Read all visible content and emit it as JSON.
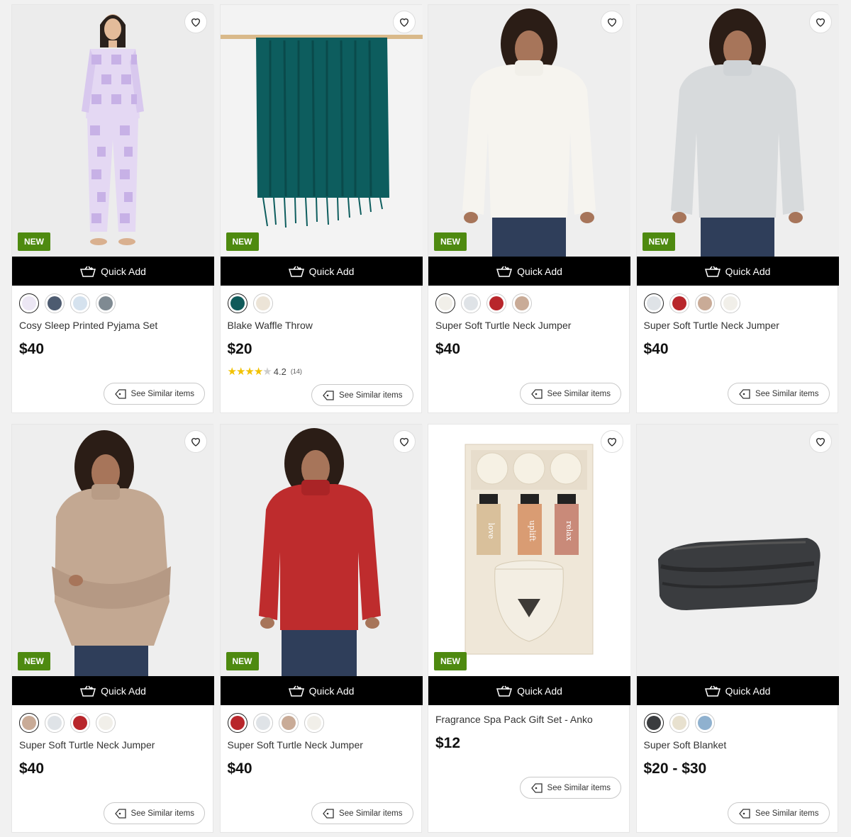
{
  "ui": {
    "quick_add": "Quick Add",
    "see_similar": "See Similar items",
    "new_badge": "NEW"
  },
  "products": [
    {
      "name": "Cosy Sleep Printed Pyjama Set",
      "price": "$40",
      "is_new": true,
      "swatches": [
        "#ece7f4",
        "#4d5b70",
        "#d5e2ee",
        "#7f8a92"
      ],
      "image": "pyjama"
    },
    {
      "name": "Blake Waffle Throw",
      "price": "$20",
      "is_new": true,
      "swatches": [
        "#0f5a5a",
        "#ece4d7"
      ],
      "rating": "4.2",
      "reviews": "(14)",
      "image": "throw"
    },
    {
      "name": "Super Soft Turtle Neck Jumper",
      "price": "$40",
      "is_new": true,
      "swatches": [
        "#f1efe9",
        "#dfe3e7",
        "#b8262b",
        "#c9ab97"
      ],
      "image": "jumper-cream"
    },
    {
      "name": "Super Soft Turtle Neck Jumper",
      "price": "$40",
      "is_new": true,
      "swatches": [
        "#dfe3e7",
        "#b8262b",
        "#c9ab97",
        "#f1efe9"
      ],
      "image": "jumper-grey"
    },
    {
      "name": "Super Soft Turtle Neck Jumper",
      "price": "$40",
      "is_new": true,
      "swatches": [
        "#c9ab97",
        "#dfe3e7",
        "#b8262b",
        "#f1efe9"
      ],
      "image": "jumper-beige"
    },
    {
      "name": "Super Soft Turtle Neck Jumper",
      "price": "$40",
      "is_new": true,
      "swatches": [
        "#b8262b",
        "#dfe3e7",
        "#c9ab97",
        "#f1efe9"
      ],
      "image": "jumper-red"
    },
    {
      "name": "Fragrance Spa Pack Gift Set - Anko",
      "price": "$12",
      "is_new": true,
      "swatches": [],
      "image": "spa-pack"
    },
    {
      "name": "Super Soft Blanket",
      "price": "$20 - $30",
      "is_new": false,
      "swatches": [
        "#3a3c3f",
        "#e8e1cf",
        "#8fb1cf"
      ],
      "image": "blanket"
    }
  ],
  "spa_labels": [
    "love",
    "uplift",
    "relax"
  ]
}
